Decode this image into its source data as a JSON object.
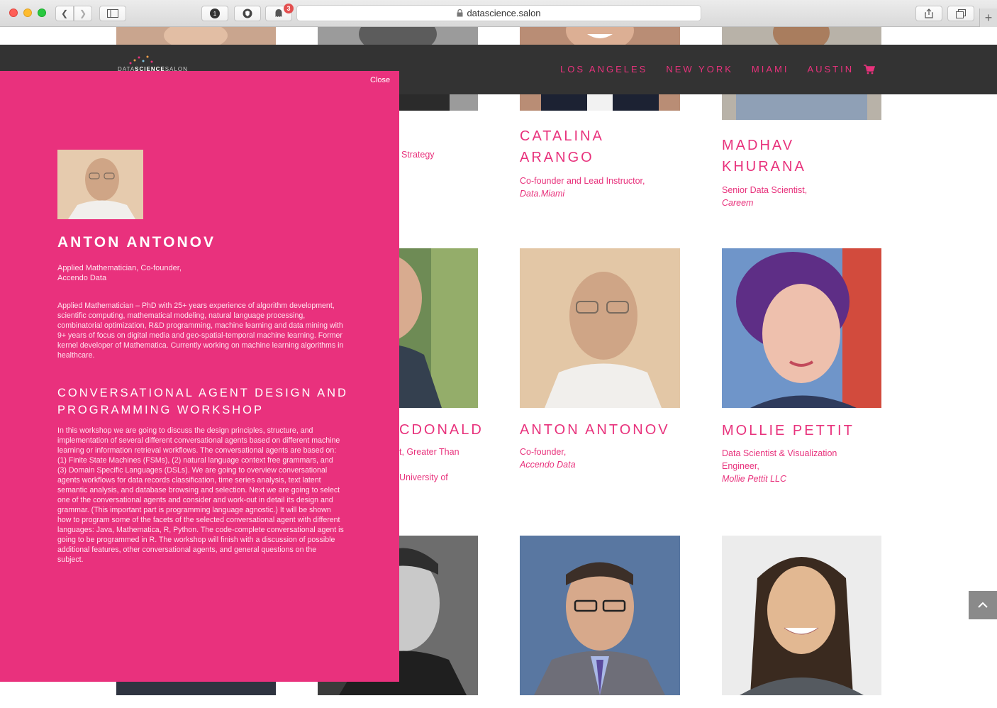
{
  "browser": {
    "url": "datascience.salon",
    "tab_count": "1",
    "notification_count": "3"
  },
  "nav": {
    "logo_prefix": "DATA",
    "logo_bold": "SCIENCE",
    "logo_suffix": "SALON",
    "links": [
      "LOS ANGELES",
      "NEW YORK",
      "MIAMI",
      "AUSTIN"
    ]
  },
  "speakers": {
    "row1": [
      {
        "name": "I",
        "role": "Strategy"
      },
      {
        "name": "CATALINA ARANGO",
        "role": "Co-founder and Lead Instructor,",
        "company": "Data.Miami"
      },
      {
        "name": "MADHAV KHURANA",
        "role": "Senior Data Scientist,",
        "company": "Careem"
      }
    ],
    "row2": [
      {
        "name": "CDONALD",
        "role_line1": "t, Greater Than",
        "role_line2": "University of"
      },
      {
        "name": "ANTON ANTONOV",
        "role": "Co-founder,",
        "company": "Accendo Data"
      },
      {
        "name": "MOLLIE PETTIT",
        "role": "Data Scientist & Visualization Engineer,",
        "company": "Mollie Pettit LLC"
      }
    ]
  },
  "modal": {
    "close_label": "Close",
    "name": "ANTON ANTONOV",
    "role_line1": "Applied Mathematician, Co-founder,",
    "role_line2": "Accendo Data",
    "bio": "Applied Mathematician – PhD with 25+ years experience of algorithm development, scientific computing, mathematical modeling, natural language processing, combinatorial optimization, R&D programming, machine learning and data mining with 9+ years of focus on digital media and geo-spatial-temporal machine learning. Former kernel developer of Mathematica. Currently working on machine learning algorithms in healthcare.",
    "workshop_title": "CONVERSATIONAL AGENT DESIGN AND PROGRAMMING WORKSHOP",
    "workshop_desc": "In this workshop we are going to discuss the design principles, structure, and implementation of several different conversational agents based on different machine learning or information retrieval workflows. The conversational agents are based on: (1) Finite State Machines (FSMs), (2) natural language context free grammars, and (3) Domain Specific Languages (DSLs). We are going to overview conversational agents workflows for data records classification, time series analysis, text latent semantic analysis, and database browsing and selection. Next we are going to select one of the conversational agents and consider and work-out in detail its design and grammar. (This important part is programming language agnostic.) It will be shown how to program some of the facets of the selected conversational agent with different languages: Java, Mathematica, R, Python. The code-complete conversational agent is going to be programmed in R. The workshop will finish with a discussion of possible additional features, other conversational agents, and general questions on the subject."
  },
  "colors": {
    "accent": "#e8327c",
    "modal_bg": "#e9317d",
    "navbar_bg": "#333333"
  }
}
